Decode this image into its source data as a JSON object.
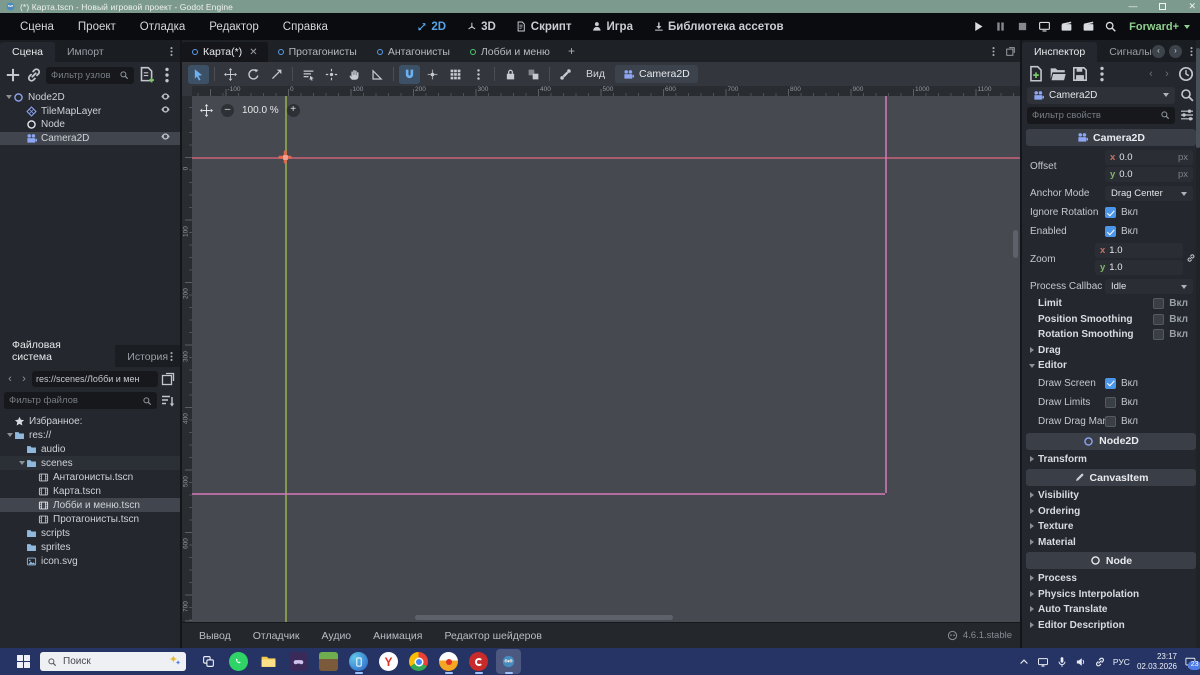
{
  "window": {
    "title": "(*) Карта.tscn - Новый игровой проект - Godot Engine"
  },
  "menubar": {
    "menus": [
      "Сцена",
      "Проект",
      "Отладка",
      "Редактор",
      "Справка"
    ],
    "workspaces": [
      {
        "label": "2D",
        "icon": "workspace-2d",
        "active": true
      },
      {
        "label": "3D",
        "icon": "workspace-3d",
        "active": false
      },
      {
        "label": "Скрипт",
        "icon": "script",
        "active": false
      },
      {
        "label": "Игра",
        "icon": "person",
        "active": false
      },
      {
        "label": "Библиотека ассетов",
        "icon": "download",
        "active": false
      }
    ],
    "playback": [
      {
        "icon": "play",
        "name": "play-button",
        "dim": false
      },
      {
        "icon": "pause",
        "name": "pause-button",
        "dim": true
      },
      {
        "icon": "stop",
        "name": "stop-button",
        "dim": true
      },
      {
        "icon": "remote-window",
        "name": "remote-debug-button",
        "dim": false
      },
      {
        "icon": "movie",
        "name": "movie-maker-button",
        "dim": false
      },
      {
        "icon": "movie",
        "name": "movie-writer-button",
        "dim": false
      },
      {
        "icon": "magnifier",
        "name": "profiler-button",
        "dim": false
      }
    ],
    "renderer": "Forward+"
  },
  "scene_panel": {
    "tabs": [
      {
        "label": "Сцена",
        "active": true
      },
      {
        "label": "Импорт",
        "active": false
      }
    ],
    "filter_placeholder": "Фильтр узлов",
    "tree": [
      {
        "label": "Node2D",
        "icon": "node-circle",
        "color": "#8da5f3",
        "depth": 0,
        "expanded": true,
        "eye": true,
        "selected": false
      },
      {
        "label": "TileMapLayer",
        "icon": "tilemap-diamond",
        "color": "#8da5f3",
        "depth": 1,
        "eye": true,
        "selected": false
      },
      {
        "label": "Node",
        "icon": "node-circle",
        "color": "#e8eaed",
        "depth": 1,
        "eye": false,
        "selected": false
      },
      {
        "label": "Camera2D",
        "icon": "camera",
        "color": "#8da5f3",
        "depth": 1,
        "eye": true,
        "selected": true
      }
    ]
  },
  "filesystem": {
    "tabs": [
      {
        "label": "Файловая система",
        "active": true
      },
      {
        "label": "История",
        "active": false
      }
    ],
    "path": "res://scenes/Лобби и мен",
    "filter_placeholder": "Фильтр файлов",
    "tree": [
      {
        "label": "Избранное:",
        "icon": "star",
        "color": "#d6d9dd",
        "depth": 0
      },
      {
        "label": "res://",
        "icon": "folder",
        "color": "#90b7dc",
        "depth": 0,
        "expanded": true
      },
      {
        "label": "audio",
        "icon": "folder",
        "color": "#90b7dc",
        "depth": 1
      },
      {
        "label": "scenes",
        "icon": "folder",
        "color": "#90b7dc",
        "depth": 1,
        "expanded": true,
        "hover": true
      },
      {
        "label": "Антагонисты.tscn",
        "icon": "scene-film",
        "color": "#c9cdd3",
        "depth": 2
      },
      {
        "label": "Карта.tscn",
        "icon": "scene-film",
        "color": "#c9cdd3",
        "depth": 2
      },
      {
        "label": "Лобби и меню.tscn",
        "icon": "scene-film",
        "color": "#eceef1",
        "depth": 2,
        "selected": true
      },
      {
        "label": "Протагонисты.tscn",
        "icon": "scene-film",
        "color": "#c9cdd3",
        "depth": 2
      },
      {
        "label": "scripts",
        "icon": "folder",
        "color": "#90b7dc",
        "depth": 1
      },
      {
        "label": "sprites",
        "icon": "folder",
        "color": "#90b7dc",
        "depth": 1
      },
      {
        "label": "icon.svg",
        "icon": "image",
        "color": "#90b7dc",
        "depth": 1
      }
    ]
  },
  "scene_tabs": [
    {
      "label": "Карта(*)",
      "dot_color": "#5b9ce8",
      "active": true,
      "closable": true
    },
    {
      "label": "Протагонисты",
      "dot_color": "#5b9ce8",
      "active": false,
      "closable": false
    },
    {
      "label": "Антагонисты",
      "dot_color": "#5b9ce8",
      "active": false,
      "closable": false
    },
    {
      "label": "Лобби и меню",
      "dot_color": "#49c96c",
      "active": false,
      "closable": false
    }
  ],
  "canvas_toolbar": {
    "tools": [
      {
        "icon": "cursor",
        "name": "select-tool",
        "active": true
      },
      {
        "sep": true
      },
      {
        "icon": "move",
        "name": "move-tool"
      },
      {
        "icon": "rotate",
        "name": "rotate-tool"
      },
      {
        "icon": "scale",
        "name": "scale-tool"
      },
      {
        "sep": true
      },
      {
        "icon": "list-select",
        "name": "list-select-tool"
      },
      {
        "icon": "pivot",
        "name": "edit-pivot-tool"
      },
      {
        "icon": "hand",
        "name": "pan-tool"
      },
      {
        "icon": "ruler",
        "name": "ruler-tool"
      },
      {
        "sep": true
      },
      {
        "icon": "magnet",
        "name": "smart-snap-toggle",
        "active": true
      },
      {
        "icon": "grid-snap",
        "name": "grid-snap-toggle"
      },
      {
        "icon": "grid",
        "name": "snap-options"
      },
      {
        "icon": "dots-v",
        "name": "snap-menu"
      },
      {
        "sep": true
      },
      {
        "icon": "lock",
        "name": "lock-node-button"
      },
      {
        "icon": "group",
        "name": "group-node-button"
      },
      {
        "sep": true
      },
      {
        "icon": "bone",
        "name": "skeleton-options"
      }
    ],
    "view_menu": "Вид",
    "context_button": "Camera2D"
  },
  "viewport": {
    "zoom_label": "100.0 %",
    "ruler_h_values": [
      -100,
      0,
      100,
      200,
      300,
      400,
      500,
      600,
      700,
      800,
      900,
      1000,
      1100
    ],
    "ruler_v_values": [
      0,
      100,
      200,
      300,
      400,
      500,
      600,
      700
    ]
  },
  "bottom_bar": {
    "items": [
      "Вывод",
      "Отладчик",
      "Аудио",
      "Анимация",
      "Редактор шейдеров"
    ],
    "version": "4.6.1.stable"
  },
  "inspector": {
    "tabs": [
      {
        "label": "Инспектор",
        "active": true
      },
      {
        "label": "Сигналы",
        "active": false
      }
    ],
    "node_selector": "Camera2D",
    "filter_placeholder": "Фильтр свойств",
    "rows": [
      {
        "type": "section",
        "label": "Camera2D",
        "icon": "camera",
        "icon_color": "#8da5f3"
      },
      {
        "type": "vector",
        "label": "Offset",
        "x": "0.0",
        "y": "0.0",
        "suffix": "px",
        "link": false
      },
      {
        "type": "dropdown",
        "label": "Anchor Mode",
        "value": "Drag Center"
      },
      {
        "type": "check",
        "label": "Ignore Rotation",
        "checked": true,
        "check_label": "Вкл"
      },
      {
        "type": "check",
        "label": "Enabled",
        "checked": true,
        "check_label": "Вкл"
      },
      {
        "type": "vector",
        "label": "Zoom",
        "x": "1.0",
        "y": "1.0",
        "suffix": "",
        "link": true
      },
      {
        "type": "dropdown",
        "label": "Process Callbac",
        "value": "Idle"
      },
      {
        "type": "group-check",
        "label": "Limit",
        "checked": false,
        "check_label": "Вкл"
      },
      {
        "type": "group-check",
        "label": "Position Smoothing",
        "checked": false,
        "check_label": "Вкл"
      },
      {
        "type": "group-check",
        "label": "Rotation Smoothing",
        "checked": false,
        "check_label": "Вкл"
      },
      {
        "type": "group",
        "label": "Drag",
        "expanded": false
      },
      {
        "type": "group",
        "label": "Editor",
        "expanded": true
      },
      {
        "type": "check",
        "label": "Draw Screen",
        "checked": true,
        "check_label": "Вкл",
        "indent": 1
      },
      {
        "type": "check",
        "label": "Draw Limits",
        "checked": false,
        "check_label": "Вкл",
        "indent": 1
      },
      {
        "type": "check",
        "label": "Draw Drag Marg",
        "checked": false,
        "check_label": "Вкл",
        "indent": 1
      },
      {
        "type": "section",
        "label": "Node2D",
        "icon": "node-circle",
        "icon_color": "#8da5f3"
      },
      {
        "type": "group",
        "label": "Transform",
        "expanded": false
      },
      {
        "type": "section",
        "label": "CanvasItem",
        "icon": "pencil",
        "icon_color": "#cdd1d6"
      },
      {
        "type": "group",
        "label": "Visibility",
        "expanded": false
      },
      {
        "type": "group",
        "label": "Ordering",
        "expanded": false
      },
      {
        "type": "group",
        "label": "Texture",
        "expanded": false
      },
      {
        "type": "group",
        "label": "Material",
        "expanded": false
      },
      {
        "type": "section",
        "label": "Node",
        "icon": "node-circle",
        "icon_color": "#e8eaed"
      },
      {
        "type": "group",
        "label": "Process",
        "expanded": false
      },
      {
        "type": "group",
        "label": "Physics Interpolation",
        "expanded": false
      },
      {
        "type": "group",
        "label": "Auto Translate",
        "expanded": false
      },
      {
        "type": "group",
        "label": "Editor Description",
        "expanded": false
      }
    ]
  },
  "taskbar": {
    "search_placeholder": "Поиск",
    "apps": [
      {
        "name": "task-view",
        "running": false
      },
      {
        "name": "whatsapp",
        "running": false
      },
      {
        "name": "explorer",
        "running": false
      },
      {
        "name": "game",
        "running": false
      },
      {
        "name": "minecraft",
        "running": false
      },
      {
        "name": "phone-link",
        "running": true
      },
      {
        "name": "yandex-browser",
        "running": false
      },
      {
        "name": "chrome",
        "running": false
      },
      {
        "name": "yandex-start",
        "running": true
      },
      {
        "name": "opera-red",
        "running": true
      },
      {
        "name": "godot",
        "running": true,
        "active": true
      }
    ],
    "lang": "РУС",
    "time": "23:17",
    "date": "02.03.2026",
    "notifications": "23"
  }
}
